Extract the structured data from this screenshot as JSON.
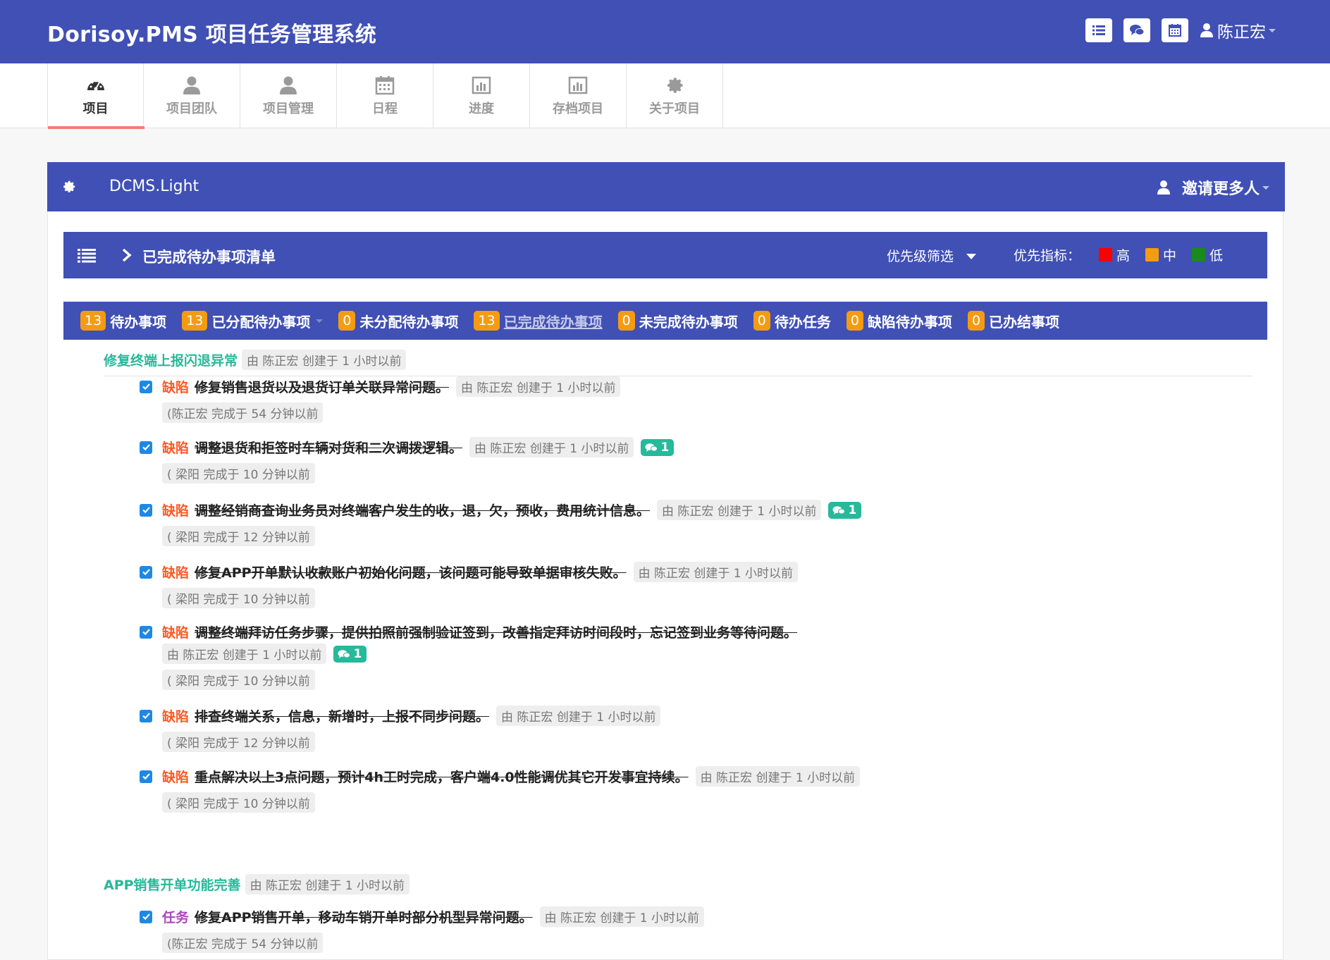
{
  "header": {
    "brand": "Dorisoy.PMS 项目任务管理系统",
    "icons": [
      "list-icon",
      "comments-icon",
      "calendar-icon"
    ],
    "user_name": "陈正宏"
  },
  "nav": {
    "tabs": [
      {
        "label": "项目",
        "icon": "dashboard-icon",
        "active": true
      },
      {
        "label": "项目团队",
        "icon": "user-icon",
        "active": false
      },
      {
        "label": "项目管理",
        "icon": "user-icon",
        "active": false
      },
      {
        "label": "日程",
        "icon": "calendar-icon",
        "active": false
      },
      {
        "label": "进度",
        "icon": "bar-chart-icon",
        "active": false
      },
      {
        "label": "存档项目",
        "icon": "bar-chart-icon",
        "active": false
      },
      {
        "label": "关于项目",
        "icon": "gear-icon",
        "active": false
      }
    ]
  },
  "project": {
    "name": "DCMS.Light",
    "invite_label": "邀请更多人"
  },
  "list": {
    "title": "已完成待办事项清单",
    "priority_filter": "优先级筛选",
    "priority_legend_label": "优先指标：",
    "legend": [
      {
        "label": "高",
        "color": "#ff0000"
      },
      {
        "label": "中",
        "color": "#f59b11"
      },
      {
        "label": "低",
        "color": "#1a8a1a"
      }
    ]
  },
  "filters": [
    {
      "count": "13",
      "label": "待办事项"
    },
    {
      "count": "13",
      "label": "已分配待办事项"
    },
    {
      "count": "0",
      "label": "未分配待办事项"
    },
    {
      "count": "13",
      "label": "已完成待办事项"
    },
    {
      "count": "0",
      "label": "未完成待办事项"
    },
    {
      "count": "0",
      "label": "待办任务"
    },
    {
      "count": "0",
      "label": "缺陷待办事项"
    },
    {
      "count": "0",
      "label": "已办结事项"
    }
  ],
  "groups": [
    {
      "title": "修复终端上报闪退异常",
      "meta": "由 陈正宏 创建于 1 小时以前",
      "todos": [
        {
          "type": "缺陷",
          "text": "修复销售退货以及退货订单关联异常问题。",
          "meta": "由 陈正宏 创建于 1 小时以前",
          "comments": "",
          "done": "(陈正宏 完成于 54 分钟以前"
        },
        {
          "type": "缺陷",
          "text": "调整退货和拒签时车辆对货和二次调拨逻辑。",
          "meta": "由 陈正宏 创建于 1 小时以前",
          "comments": "1",
          "done": "( 梁阳 完成于 10 分钟以前"
        },
        {
          "type": "缺陷",
          "text": "调整经销商查询业务员对终端客户发生的收，退，欠，预收，费用统计信息。",
          "meta": "由 陈正宏 创建于 1 小时以前",
          "comments": "1",
          "done": "( 梁阳 完成于 12 分钟以前"
        },
        {
          "type": "缺陷",
          "text": "修复APP开单默认收款账户初始化问题，该问题可能导致单据审核失败。",
          "meta": "由 陈正宏 创建于 1 小时以前",
          "comments": "",
          "done": "( 梁阳 完成于 10 分钟以前"
        },
        {
          "type": "缺陷",
          "text": "调整终端拜访任务步骤，提供拍照前强制验证签到，改善指定拜访时间段时，忘记签到业务等待问题。",
          "meta": "由 陈正宏 创建于 1 小时以前",
          "comments": "1",
          "done": "( 梁阳 完成于 10 分钟以前"
        },
        {
          "type": "缺陷",
          "text": "排查终端关系，信息，新增时，上报不同步问题。",
          "meta": "由 陈正宏 创建于 1 小时以前",
          "comments": "",
          "done": "( 梁阳 完成于 12 分钟以前"
        },
        {
          "type": "缺陷",
          "text": "重点解决以上3点问题，预计4h工时完成，客户端4.0性能调优其它开发事宜持续。",
          "meta": "由 陈正宏 创建于 1 小时以前",
          "comments": "",
          "done": "( 梁阳 完成于 10 分钟以前"
        }
      ]
    },
    {
      "title": "APP销售开单功能完善",
      "meta": "由 陈正宏 创建于 1 小时以前",
      "todos": [
        {
          "type": "任务",
          "text": "修复APP销售开单，移动车销开单时部分机型异常问题。",
          "meta": "由 陈正宏 创建于 1 小时以前",
          "comments": "",
          "done": "(陈正宏 完成于 54 分钟以前"
        }
      ]
    }
  ]
}
